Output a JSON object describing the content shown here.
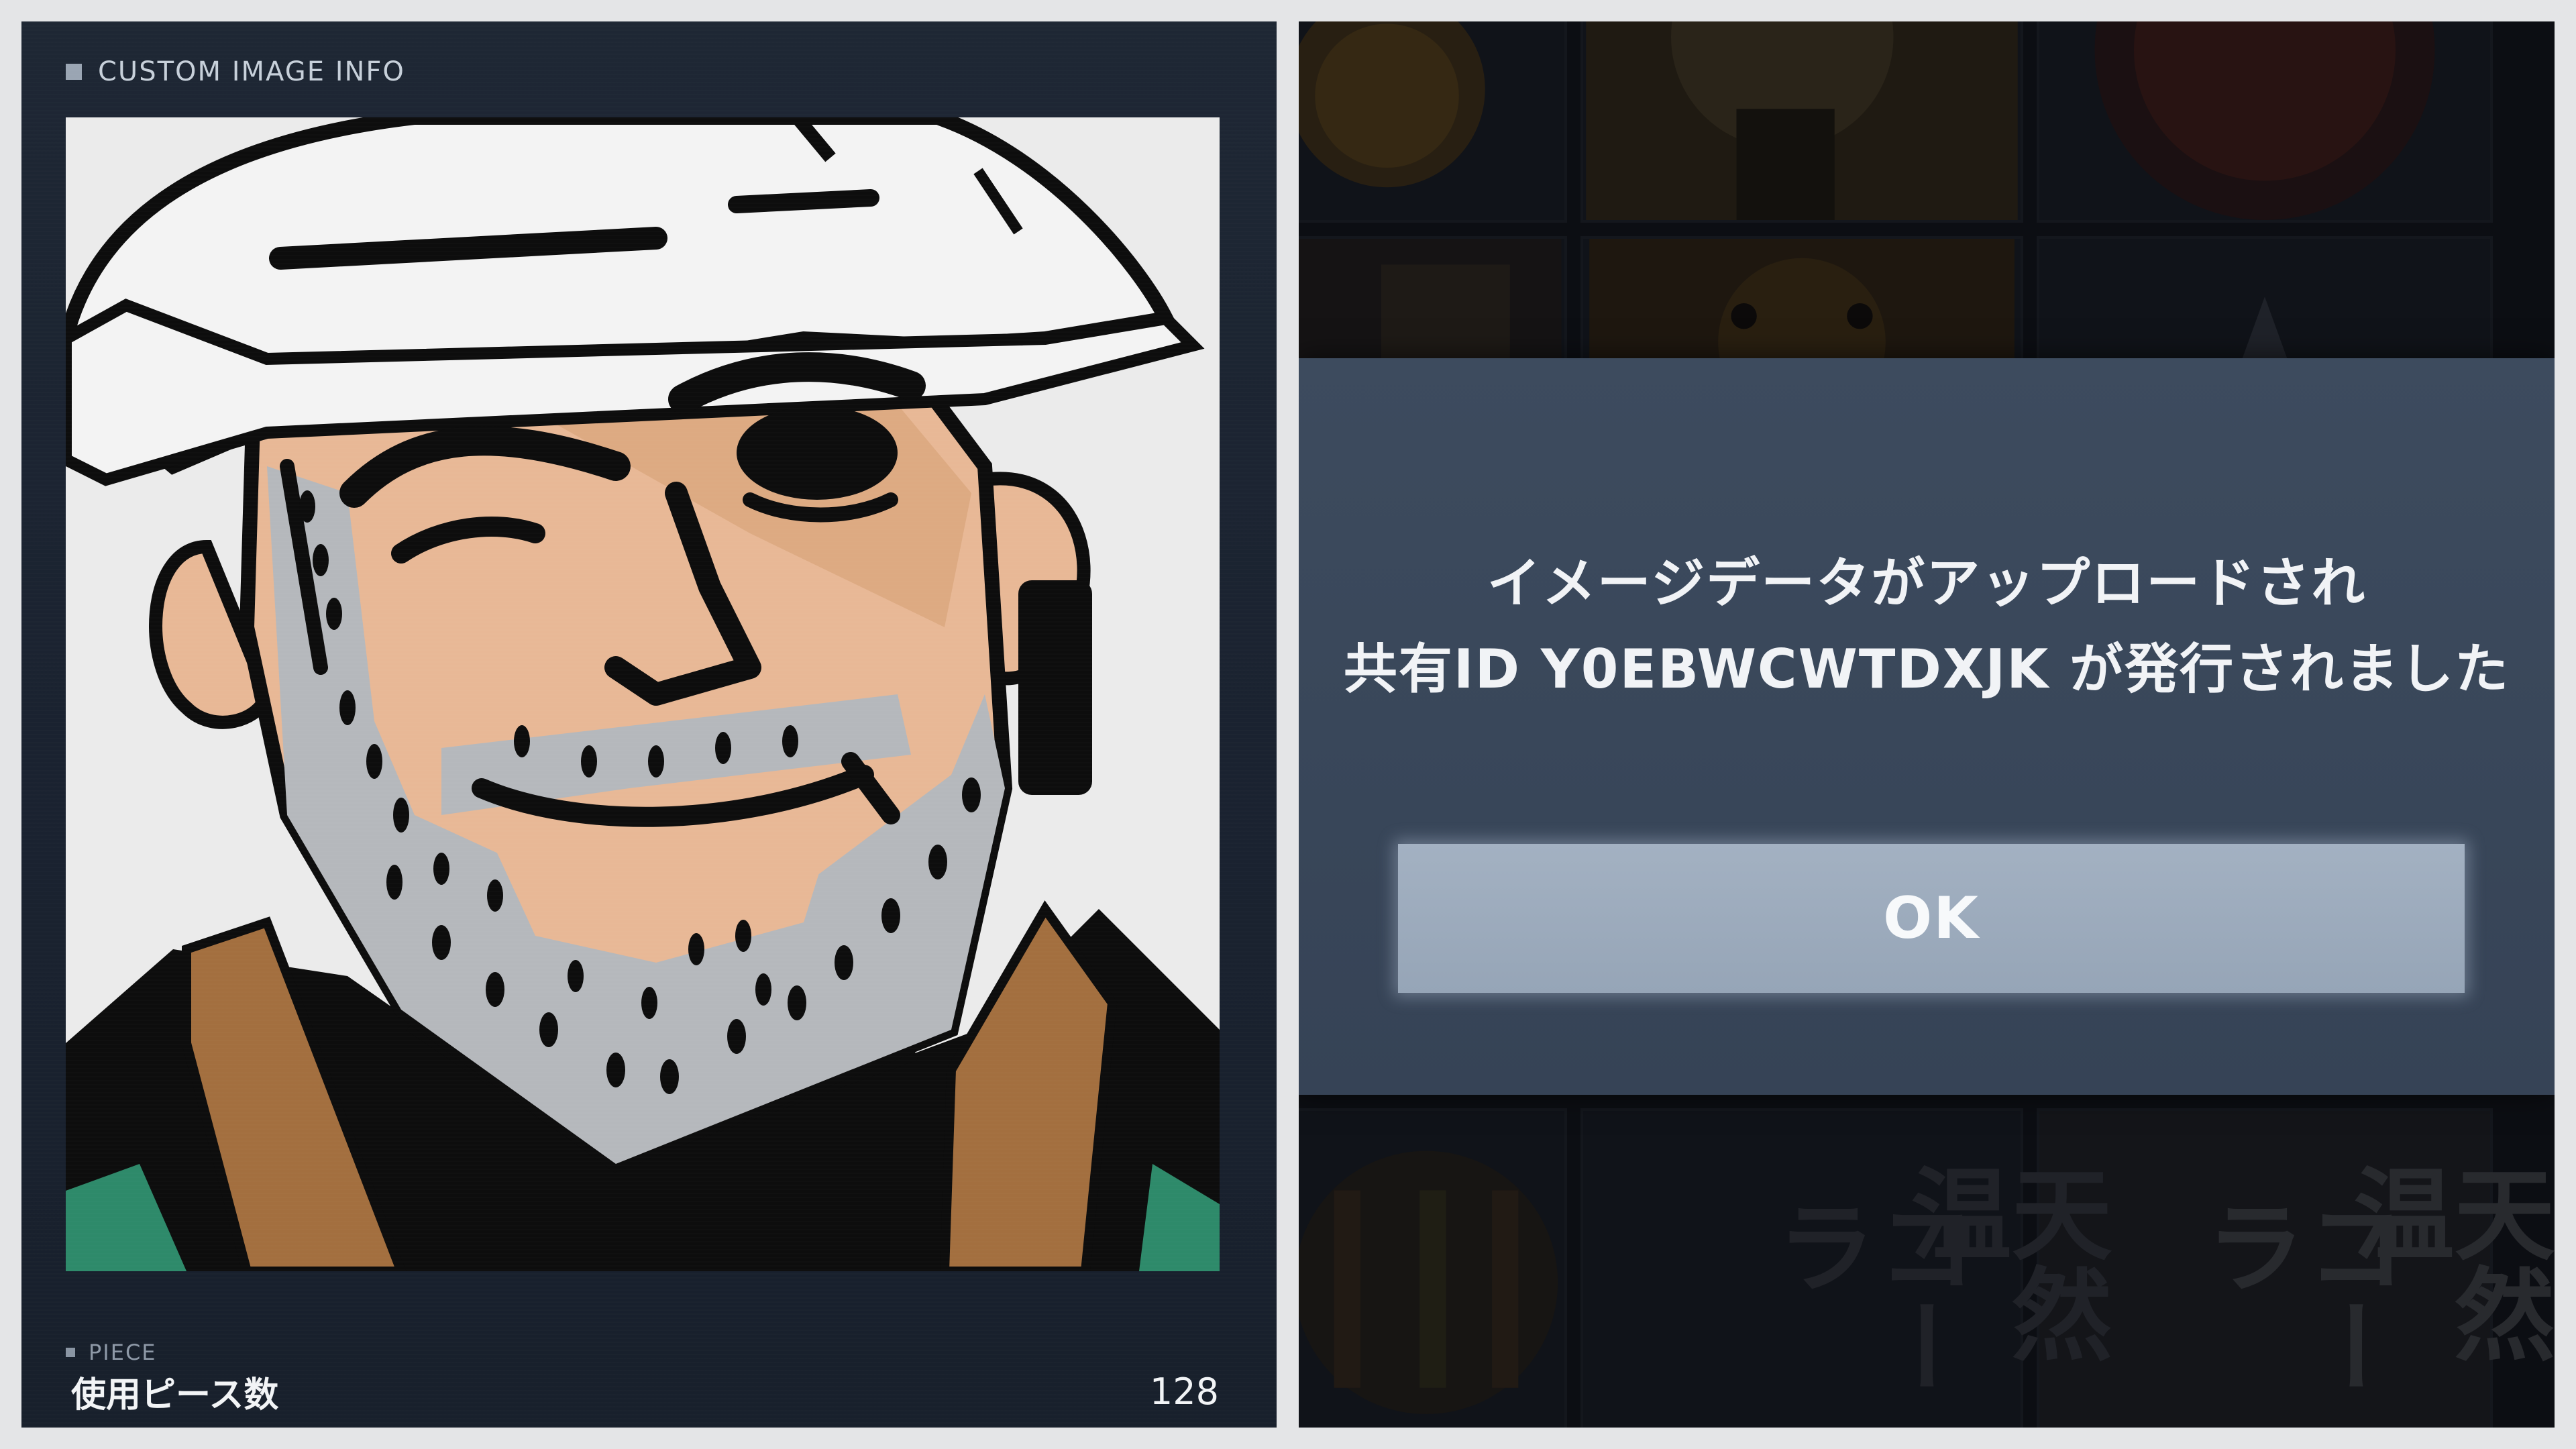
{
  "left_panel": {
    "section_title": "CUSTOM IMAGE INFO",
    "portrait_icon": "helmeted-man-portrait",
    "piece_label": "PIECE",
    "piece_name": "使用ピース数",
    "piece_value": "128"
  },
  "right_panel": {
    "background_kanji": [
      "天然温",
      "コーラ",
      "天然温",
      "コーラ"
    ],
    "dialog": {
      "message_line_1": "イメージデータがアップロードされ",
      "message_line_2": "共有ID Y0EBWCWTDXJK が発行されました",
      "ok_label": "OK"
    }
  },
  "colors": {
    "panel_bg": "#1e2734",
    "dialog_bg": "#3d4b5e",
    "button_bg": "#a3b1c2",
    "skin": "#e8b896",
    "stubble": "#b5b8bc",
    "jacket_brown": "#a36f3f",
    "collar_green": "#2e8a6a"
  }
}
